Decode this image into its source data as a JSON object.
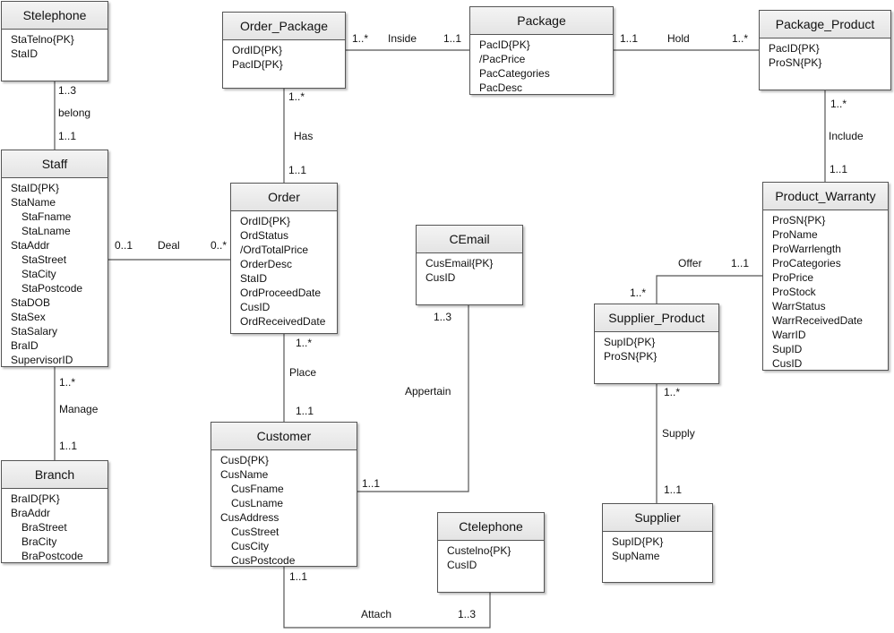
{
  "entities": [
    {
      "name": "Stelephone",
      "attributes": [
        {
          "text": "StaTelno{PK}"
        },
        {
          "text": "StaID"
        }
      ]
    },
    {
      "name": "Order_Package",
      "attributes": [
        {
          "text": "OrdID{PK}"
        },
        {
          "text": "PacID{PK}"
        }
      ]
    },
    {
      "name": "Package",
      "attributes": [
        {
          "text": "PacID{PK}"
        },
        {
          "text": "/PacPrice"
        },
        {
          "text": "PacCategories"
        },
        {
          "text": "PacDesc"
        }
      ]
    },
    {
      "name": "Package_Product",
      "attributes": [
        {
          "text": "PacID{PK}"
        },
        {
          "text": "ProSN{PK}"
        }
      ]
    },
    {
      "name": "Staff",
      "attributes": [
        {
          "text": "StaID{PK}"
        },
        {
          "text": "StaName"
        },
        {
          "text": "StaFname",
          "sub": true
        },
        {
          "text": "StaLname",
          "sub": true
        },
        {
          "text": "StaAddr"
        },
        {
          "text": "StaStreet",
          "sub": true
        },
        {
          "text": "StaCity",
          "sub": true
        },
        {
          "text": "StaPostcode",
          "sub": true
        },
        {
          "text": "StaDOB"
        },
        {
          "text": "StaSex"
        },
        {
          "text": "StaSalary"
        },
        {
          "text": "BraID"
        },
        {
          "text": "SupervisorID"
        }
      ]
    },
    {
      "name": "Order",
      "attributes": [
        {
          "text": "OrdID{PK}"
        },
        {
          "text": "OrdStatus"
        },
        {
          "text": "/OrdTotalPrice"
        },
        {
          "text": "OrderDesc"
        },
        {
          "text": "StaID"
        },
        {
          "text": "OrdProceedDate"
        },
        {
          "text": "CusID"
        },
        {
          "text": "OrdReceivedDate"
        }
      ]
    },
    {
      "name": "CEmail",
      "attributes": [
        {
          "text": "CusEmail{PK}"
        },
        {
          "text": "CusID"
        }
      ]
    },
    {
      "name": "Product_Warranty",
      "attributes": [
        {
          "text": "ProSN{PK}"
        },
        {
          "text": "ProName"
        },
        {
          "text": "ProWarrlength"
        },
        {
          "text": "ProCategories"
        },
        {
          "text": "ProPrice"
        },
        {
          "text": "ProStock"
        },
        {
          "text": "WarrStatus"
        },
        {
          "text": "WarrReceivedDate"
        },
        {
          "text": "WarrID"
        },
        {
          "text": "SupID"
        },
        {
          "text": "CusID"
        }
      ]
    },
    {
      "name": "Supplier_Product",
      "attributes": [
        {
          "text": "SupID{PK}"
        },
        {
          "text": "ProSN{PK}"
        }
      ]
    },
    {
      "name": "Customer",
      "attributes": [
        {
          "text": "CusD{PK}"
        },
        {
          "text": "CusName"
        },
        {
          "text": "CusFname",
          "sub": true
        },
        {
          "text": "CusLname",
          "sub": true
        },
        {
          "text": "CusAddress"
        },
        {
          "text": "CusStreet",
          "sub": true
        },
        {
          "text": "CusCity",
          "sub": true
        },
        {
          "text": "CusPostcode",
          "sub": true
        }
      ]
    },
    {
      "name": "Branch",
      "attributes": [
        {
          "text": "BraID{PK}"
        },
        {
          "text": "BraAddr"
        },
        {
          "text": "BraStreet",
          "sub": true
        },
        {
          "text": "BraCity",
          "sub": true
        },
        {
          "text": "BraPostcode",
          "sub": true
        }
      ]
    },
    {
      "name": "Ctelephone",
      "attributes": [
        {
          "text": "Custelno{PK}"
        },
        {
          "text": "CusID"
        }
      ]
    },
    {
      "name": "Supplier",
      "attributes": [
        {
          "text": "SupID{PK}"
        },
        {
          "text": "SupName"
        }
      ]
    }
  ],
  "associations": [
    {
      "name": "belong",
      "from": "Stelephone",
      "to": "Staff",
      "labels": [
        "1..3",
        "belong",
        "1..1"
      ]
    },
    {
      "name": "Deal",
      "from": "Staff",
      "to": "Order",
      "labels": [
        "0..1",
        "Deal",
        "0..*"
      ]
    },
    {
      "name": "Has",
      "from": "Order_Package",
      "to": "Order",
      "labels": [
        "1..*",
        "Has",
        "1..1"
      ]
    },
    {
      "name": "Inside",
      "from": "Order_Package",
      "to": "Package",
      "labels": [
        "1..*",
        "Inside",
        "1..1"
      ]
    },
    {
      "name": "Hold",
      "from": "Package",
      "to": "Package_Product",
      "labels": [
        "1..1",
        "Hold",
        "1..*"
      ]
    },
    {
      "name": "Include",
      "from": "Package_Product",
      "to": "Product_Warranty",
      "labels": [
        "1..*",
        "Include",
        "1..1"
      ]
    },
    {
      "name": "Offer",
      "from": "Product_Warranty",
      "to": "Supplier_Product",
      "labels": [
        "Offer",
        "1..1",
        "1..*"
      ]
    },
    {
      "name": "Supply",
      "from": "Supplier_Product",
      "to": "Supplier",
      "labels": [
        "1..*",
        "Supply",
        "1..1"
      ]
    },
    {
      "name": "Manage",
      "from": "Staff",
      "to": "Branch",
      "labels": [
        "1..*",
        "Manage",
        "1..1"
      ]
    },
    {
      "name": "Place",
      "from": "Order",
      "to": "Customer",
      "labels": [
        "1..*",
        "Place",
        "1..1"
      ]
    },
    {
      "name": "Appertain",
      "from": "CEmail",
      "to": "Customer",
      "labels": [
        "1..3",
        "Appertain",
        "1..1"
      ]
    },
    {
      "name": "Attach",
      "from": "Customer",
      "to": "Ctelephone",
      "labels": [
        "1..1",
        "Attach",
        "1..3"
      ]
    }
  ],
  "colors": {
    "line": "#555555",
    "header": "#e8e8e8",
    "border": "#555555"
  }
}
